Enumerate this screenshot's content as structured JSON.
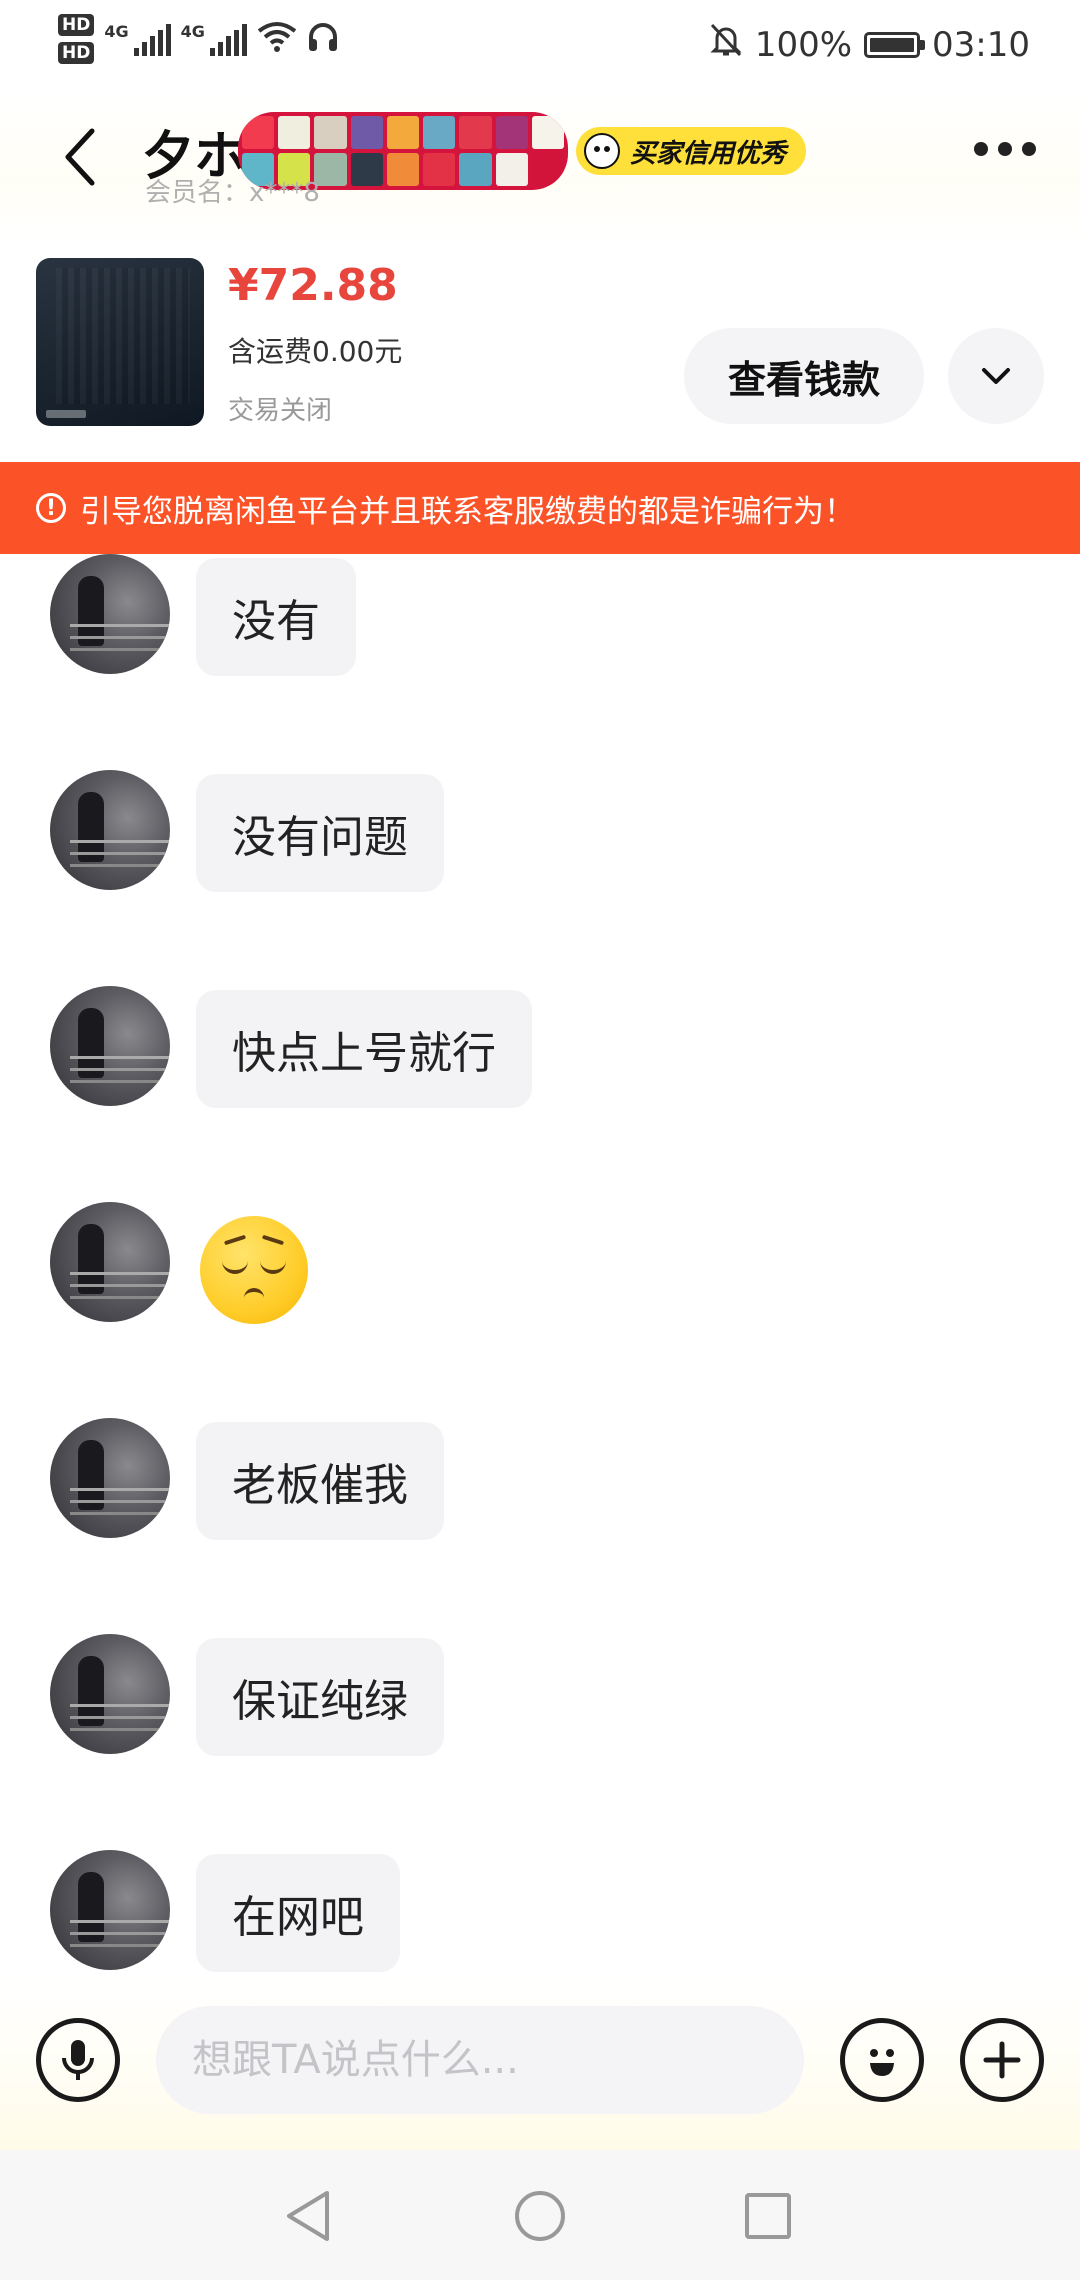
{
  "status_bar": {
    "sim1": "HD",
    "sim2": "HD",
    "net1": "4G",
    "net2": "4G",
    "battery_percent": "100%",
    "time": "03:10"
  },
  "header": {
    "title": "夕ホ",
    "credit_badge": "买家信用优秀",
    "member_name": "会员名：x***8"
  },
  "product": {
    "price": "¥72.88",
    "shipping": "含运费0.00元",
    "status": "交易关闭",
    "view_button": "查看钱款"
  },
  "warning": {
    "text": "引导您脱离闲鱼平台并且联系客服缴费的都是诈骗行为！"
  },
  "messages": [
    {
      "type": "text",
      "text": "没有"
    },
    {
      "type": "text",
      "text": "没有问题"
    },
    {
      "type": "text",
      "text": "快点上号就行"
    },
    {
      "type": "emoji",
      "emoji": "pensive-face"
    },
    {
      "type": "text",
      "text": "老板催我"
    },
    {
      "type": "text",
      "text": "保证纯绿"
    },
    {
      "type": "text",
      "text": "在网吧"
    }
  ],
  "input": {
    "placeholder": "想跟TA说点什么..."
  },
  "colors": {
    "price": "#e8453c",
    "warning_bg": "#fb5228",
    "credit_badge": "#ffe03a",
    "bubble_bg": "#f3f3f5"
  }
}
